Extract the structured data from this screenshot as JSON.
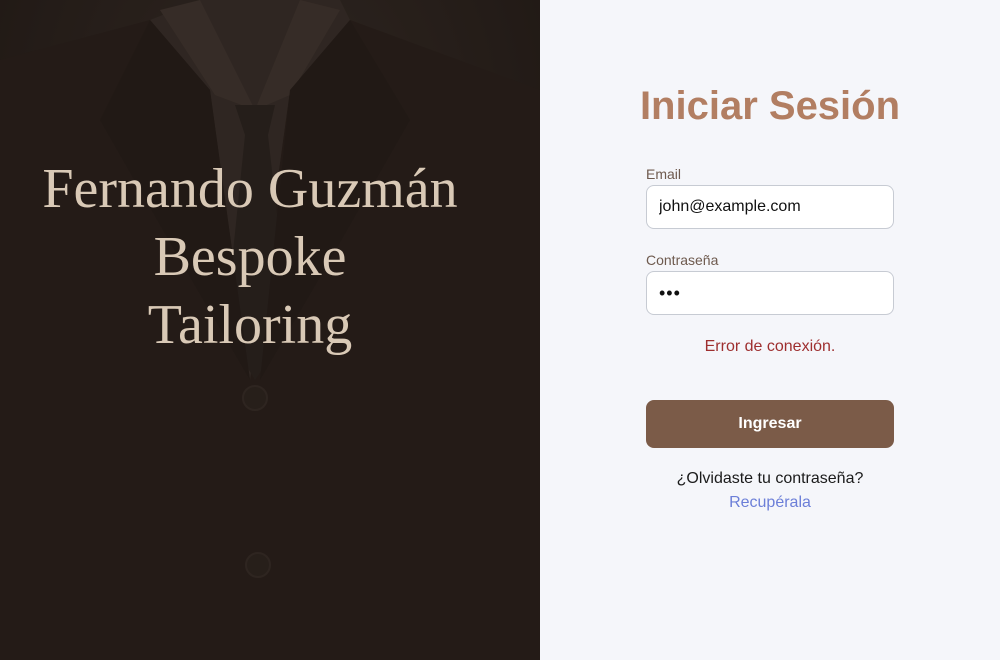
{
  "brand": {
    "line1": "Fernando Guzmán",
    "line2": "Bespoke",
    "line3": "Tailoring"
  },
  "login": {
    "title": "Iniciar Sesión",
    "email_label": "Email",
    "email_value": "john@example.com",
    "password_label": "Contraseña",
    "password_value": "abc",
    "error": "Error de conexión.",
    "submit_label": "Ingresar",
    "forgot_text": "¿Olvidaste tu contraseña?",
    "recover_link": "Recupérala"
  },
  "colors": {
    "accent": "#b27e62",
    "button": "#7b5b48",
    "error": "#9e2f2f",
    "link": "#6c7fd8",
    "left_bg": "#241b17"
  }
}
